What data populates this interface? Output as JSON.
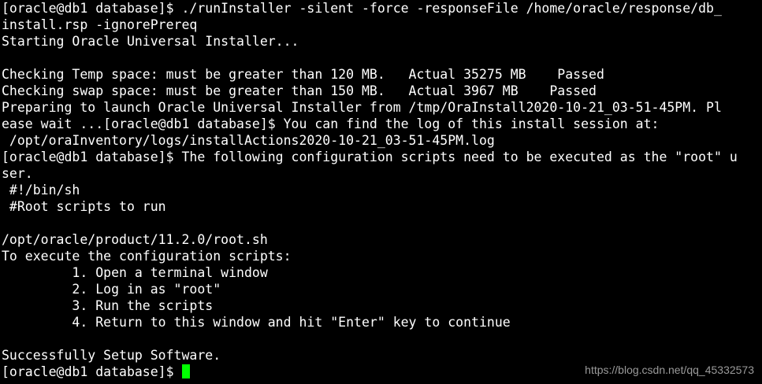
{
  "terminal": {
    "lines": [
      "[oracle@db1 database]$ ./runInstaller -silent -force -responseFile /home/oracle/response/db_",
      "install.rsp -ignorePrereq",
      "Starting Oracle Universal Installer...",
      "",
      "Checking Temp space: must be greater than 120 MB.   Actual 35275 MB    Passed",
      "Checking swap space: must be greater than 150 MB.   Actual 3967 MB    Passed",
      "Preparing to launch Oracle Universal Installer from /tmp/OraInstall2020-10-21_03-51-45PM. Pl",
      "ease wait ...[oracle@db1 database]$ You can find the log of this install session at:",
      " /opt/oraInventory/logs/installActions2020-10-21_03-51-45PM.log",
      "[oracle@db1 database]$ The following configuration scripts need to be executed as the \"root\" u",
      "ser.",
      " #!/bin/sh",
      " #Root scripts to run",
      "",
      "/opt/oracle/product/11.2.0/root.sh",
      "To execute the configuration scripts:",
      "         1. Open a terminal window",
      "         2. Log in as \"root\"",
      "         3. Run the scripts",
      "         4. Return to this window and hit \"Enter\" key to continue",
      "",
      "Successfully Setup Software."
    ],
    "prompt": "[oracle@db1 database]$ ",
    "colors": {
      "background": "#000000",
      "foreground": "#ffffff",
      "cursor": "#00ff00"
    }
  },
  "watermark": "https://blog.csdn.net/qq_45332573"
}
